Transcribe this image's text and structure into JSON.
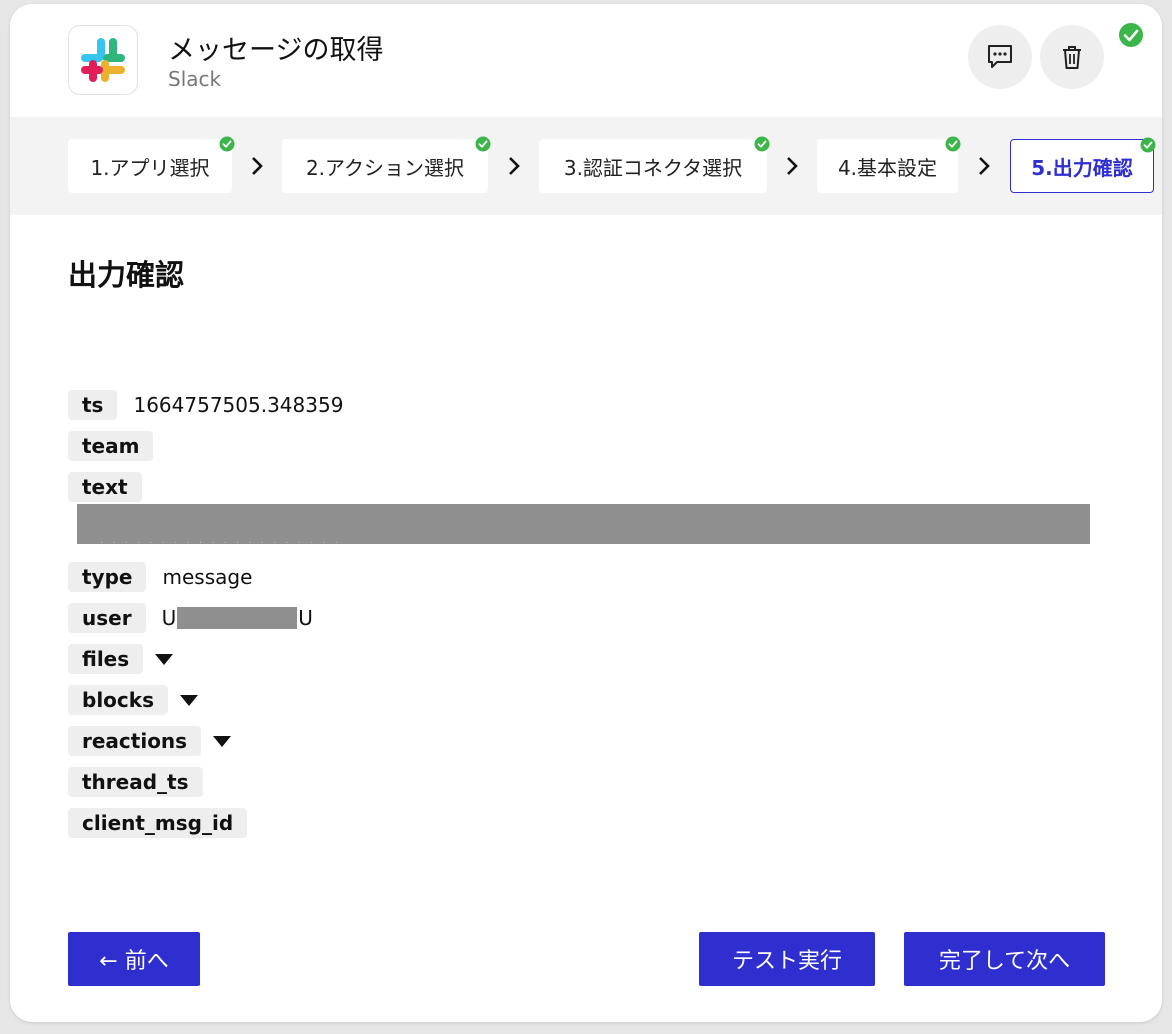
{
  "header": {
    "title": "メッセージの取得",
    "subtitle": "Slack"
  },
  "steps": [
    {
      "label": "1.アプリ選択",
      "done": true
    },
    {
      "label": "2.アクション選択",
      "done": true
    },
    {
      "label": "3.認証コネクタ選択",
      "done": true
    },
    {
      "label": "4.基本設定",
      "done": true
    },
    {
      "label": "5.出力確認",
      "done": true,
      "active": true
    }
  ],
  "section_title": "出力確認",
  "fields": {
    "ts": {
      "key": "ts",
      "value": "1664757505.348359"
    },
    "team": {
      "key": "team"
    },
    "text": {
      "key": "text"
    },
    "type": {
      "key": "type",
      "value": "message"
    },
    "user": {
      "key": "user",
      "prefix": "U",
      "suffix": "U"
    },
    "files": {
      "key": "files"
    },
    "blocks": {
      "key": "blocks"
    },
    "reactions": {
      "key": "reactions"
    },
    "thread_ts": {
      "key": "thread_ts"
    },
    "client_msg_id": {
      "key": "client_msg_id"
    }
  },
  "buttons": {
    "prev": "← 前へ",
    "test": "テスト実行",
    "next": "完了して次へ"
  },
  "colors": {
    "accent": "#2f2fd0",
    "success": "#3cb54a",
    "redaction": "#8f8f8f"
  }
}
